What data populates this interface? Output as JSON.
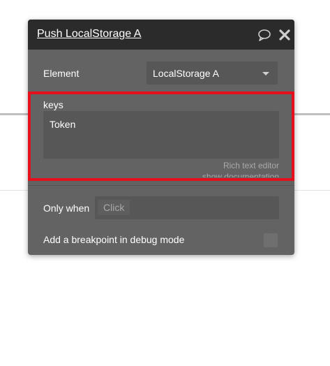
{
  "panel": {
    "title": "Push LocalStorage A",
    "header_icons": [
      "comment-icon",
      "close-icon"
    ]
  },
  "element_row": {
    "label": "Element",
    "value": "LocalStorage A"
  },
  "keys_field": {
    "label": "keys",
    "value": "Token",
    "rich_text_link": "Rich text editor",
    "documentation_link": "show documentation"
  },
  "condition": {
    "label": "Only when",
    "placeholder": "Click"
  },
  "breakpoint": {
    "label": "Add a breakpoint in debug mode",
    "checked": false
  },
  "colors": {
    "panel_bg": "#636363",
    "header_bg": "#2b2b2b",
    "field_bg": "#575757",
    "highlight": "#e5101c"
  }
}
